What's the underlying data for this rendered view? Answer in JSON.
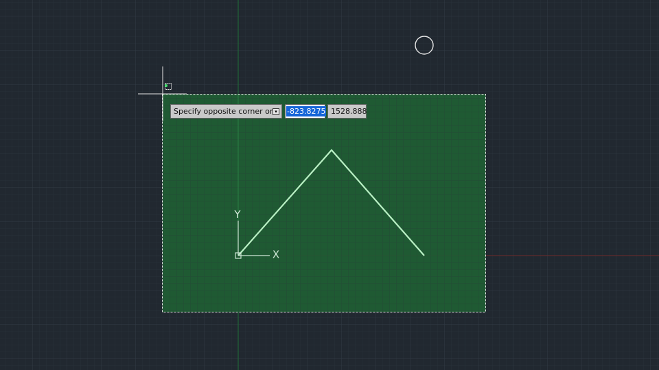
{
  "command_tooltip": {
    "prompt": "Specify opposite corner or",
    "options_glyph": "▾",
    "x_value": "-823.8275",
    "y_value": "1528.888"
  },
  "ucs_icon": {
    "x_label": "X",
    "y_label": "Y"
  },
  "colors": {
    "background": "#212830",
    "grid_minor": "#2a313b",
    "grid_major": "#323a45",
    "selection_fill": "#1f5e34",
    "selection_border": "#ffffff",
    "polyline": "#b9f0c4",
    "y_axis_line": "#1f7a3a",
    "x_axis_line": "#7a2a2a"
  }
}
